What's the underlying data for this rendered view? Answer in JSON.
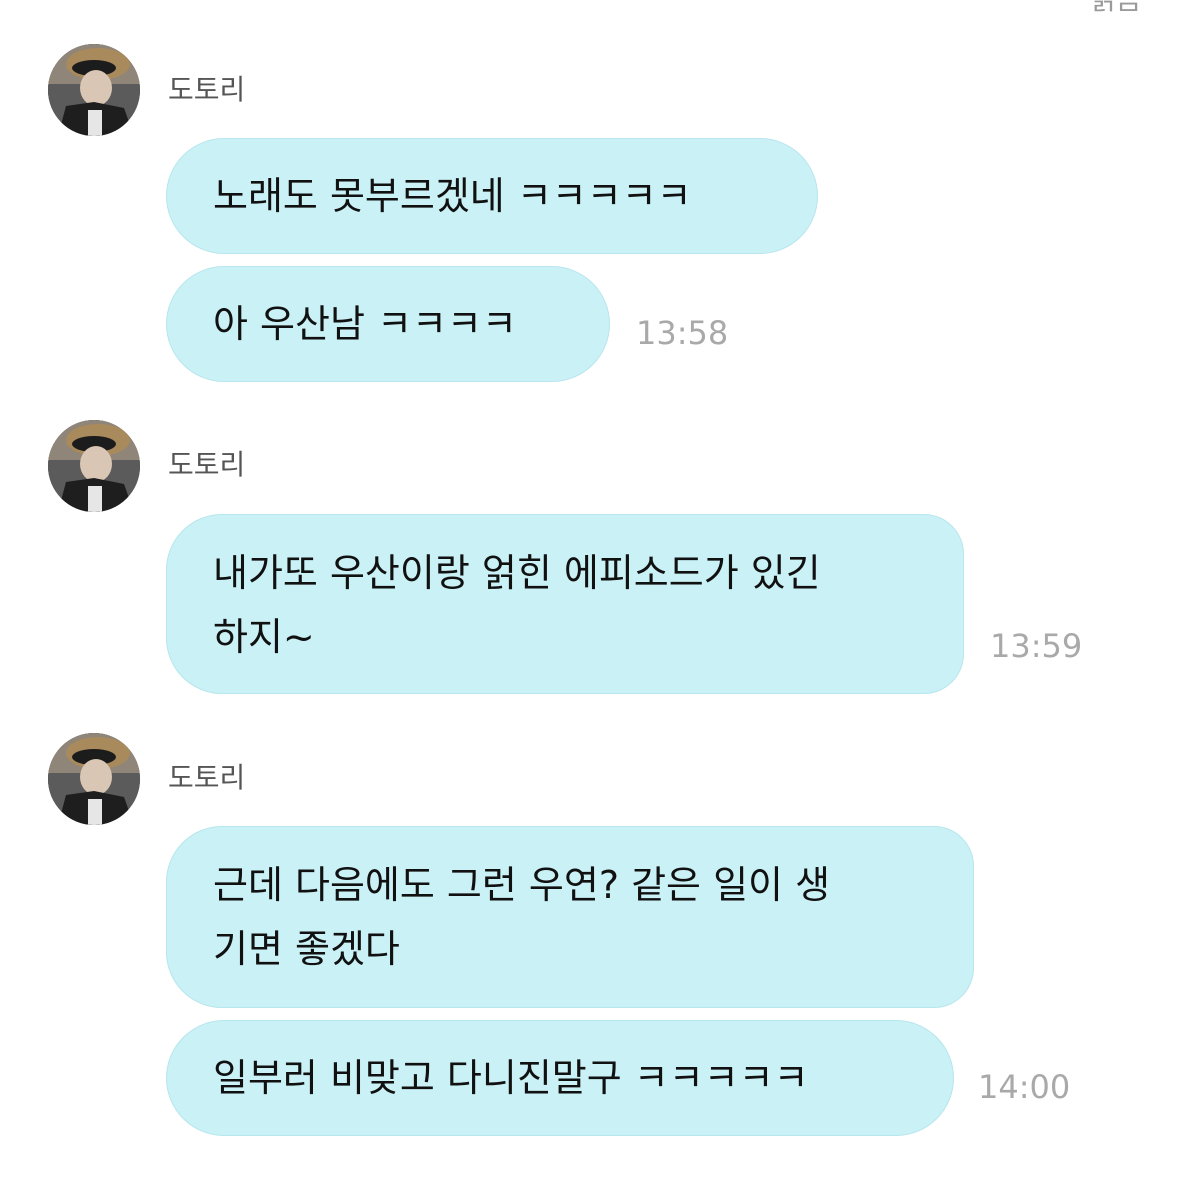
{
  "header": {
    "fragment": "읽음"
  },
  "colors": {
    "bubble": "#c9f1f6",
    "bubble_border": "#b7e6ed",
    "sender": "#555555",
    "time": "#a9a9a9",
    "text": "#111111"
  },
  "groups": [
    {
      "sender": "도토리",
      "avatar": "profile-photo-icon",
      "messages": [
        {
          "text": "노래도 못부르겠네 ㅋㅋㅋㅋㅋ"
        },
        {
          "text": "아 우산남 ㅋㅋㅋㅋ",
          "time": "13:58"
        }
      ]
    },
    {
      "sender": "도토리",
      "avatar": "profile-photo-icon",
      "messages": [
        {
          "text": "내가또 우산이랑 얽힌 에피소드가 있긴\n하지~",
          "time": "13:59"
        }
      ]
    },
    {
      "sender": "도토리",
      "avatar": "profile-photo-icon",
      "messages": [
        {
          "text": "근데 다음에도 그런 우연? 같은 일이 생\n기면 좋겠다"
        },
        {
          "text": "일부러 비맞고 다니진말구 ㅋㅋㅋㅋㅋ",
          "time": "14:00"
        }
      ]
    }
  ]
}
